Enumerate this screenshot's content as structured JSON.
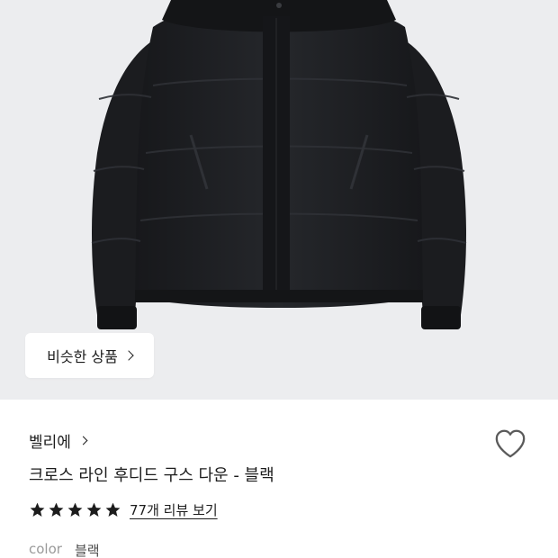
{
  "similar_button": {
    "label": "비슷한 상품"
  },
  "brand": {
    "name": "벨리에"
  },
  "product": {
    "name": "크로스 라인 후디드 구스 다운 - 블랙"
  },
  "rating": {
    "stars": 5,
    "max": 5,
    "review_link": "77개 리뷰 보기"
  },
  "color": {
    "label": "color",
    "value": "블랙"
  },
  "wishlist": {
    "icon": "heart-outline-icon",
    "active": false
  },
  "colors": {
    "hero_bg": "#ecedef",
    "jacket": "#1d1e21",
    "text": "#1c1c1c",
    "muted": "#9a9a9a"
  }
}
